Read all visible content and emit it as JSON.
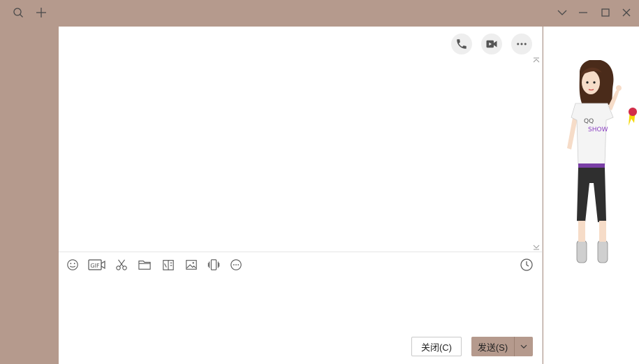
{
  "window": {
    "icons": [
      "search-icon",
      "plus-icon",
      "chevron-down-icon",
      "minimize-icon",
      "maximize-icon",
      "close-icon"
    ]
  },
  "chat": {
    "top_actions": [
      "phone-icon",
      "video-icon",
      "more-icon"
    ],
    "toolbar": [
      "emoji-icon",
      "gif-icon",
      "scissors-icon",
      "folder-icon",
      "doc-icon",
      "image-icon",
      "shake-icon",
      "more-circle-icon"
    ],
    "history_icon": "clock-icon",
    "close_label": "关闭(C)",
    "send_label": "发送(S)"
  },
  "show": {
    "shirt_line1": "QQ",
    "shirt_line2": "SHOW"
  },
  "colors": {
    "frame": "#b59a8d",
    "panel": "#ffffff",
    "icon_bg": "#eeeeee"
  }
}
